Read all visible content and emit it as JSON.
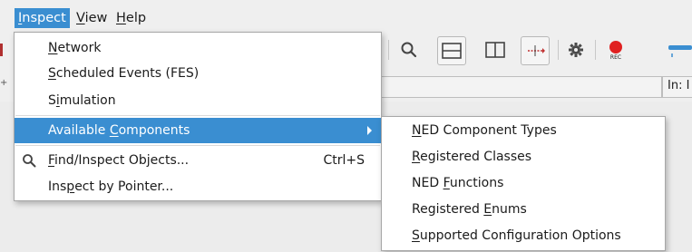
{
  "menubar": {
    "items": [
      {
        "label": "Inspect",
        "mnemonic": "I",
        "active": true
      },
      {
        "label": "View",
        "mnemonic": "V",
        "active": false
      },
      {
        "label": "Help",
        "mnemonic": "H",
        "active": false
      }
    ]
  },
  "status": {
    "in_label": "In: I"
  },
  "inspect_menu": {
    "items": [
      {
        "pre": "",
        "mn": "N",
        "post": "etwork",
        "shortcut": ""
      },
      {
        "pre": "",
        "mn": "S",
        "post": "cheduled Events (FES)",
        "shortcut": ""
      },
      {
        "pre": "S",
        "mn": "i",
        "post": "mulation",
        "shortcut": ""
      },
      {
        "pre": "Available ",
        "mn": "C",
        "post": "omponents",
        "shortcut": "",
        "highlighted": true,
        "submenu": true
      },
      {
        "pre": "",
        "mn": "F",
        "post": "ind/Inspect Objects...",
        "shortcut": "Ctrl+S",
        "icon": "search-icon"
      },
      {
        "pre": "Ins",
        "mn": "p",
        "post": "ect by Pointer...",
        "shortcut": ""
      }
    ]
  },
  "components_submenu": {
    "items": [
      {
        "pre": "",
        "mn": "N",
        "post": "ED Component Types"
      },
      {
        "pre": "",
        "mn": "R",
        "post": "egistered Classes"
      },
      {
        "pre": "NED ",
        "mn": "F",
        "post": "unctions"
      },
      {
        "pre": "Registered ",
        "mn": "E",
        "post": "nums"
      },
      {
        "pre": "",
        "mn": "S",
        "post": "upported Configuration Options"
      }
    ]
  },
  "toolbar": {
    "icons": [
      "search-icon",
      "split-horizontal-icon",
      "split-vertical-icon",
      "arrows-icon",
      "gear-icon",
      "record-icon",
      "slider-icon"
    ],
    "record_label": "REC"
  },
  "colors": {
    "highlight": "#3a8ed1",
    "record": "#e02020"
  }
}
